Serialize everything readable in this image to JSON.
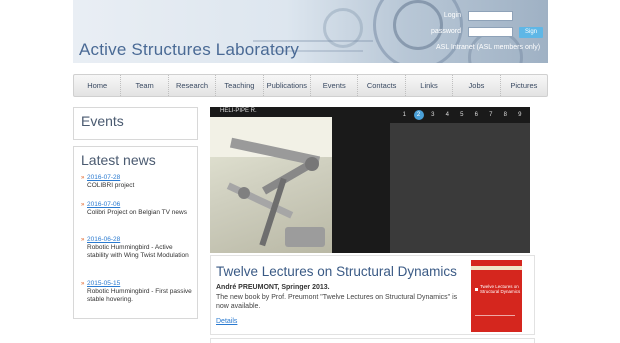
{
  "header": {
    "site_title": "Active Structures Laboratory",
    "login_label": "Login",
    "password_label": "password",
    "signin_label": "Sign",
    "intranet_text": "ASL Intranet (ASL members only)"
  },
  "nav": {
    "items": [
      "Home",
      "Team",
      "Research",
      "Teaching",
      "Publications",
      "Events",
      "Contacts",
      "Links",
      "Jobs",
      "Pictures"
    ]
  },
  "sidebar": {
    "events_title": "Events",
    "news_title": "Latest news",
    "news": [
      {
        "date": "2016-07-28",
        "text": "COLIBRI project"
      },
      {
        "date": "2016-07-06",
        "text": "Colibri Project on Belgian TV news"
      },
      {
        "date": "2016-06-28",
        "text": "Robotic Hummingbird - Active stability with Wing Twist Modulation"
      },
      {
        "date": "2015-05-15",
        "text": "Robotic Hummingbird - First passive stable hovering."
      }
    ]
  },
  "slider": {
    "caption": "HELI-PIPE R.",
    "dots": [
      "1",
      "2",
      "3",
      "4",
      "5",
      "6",
      "7",
      "8",
      "9"
    ],
    "active_index": 1
  },
  "article": {
    "title": "Twelve Lectures on Structural Dynamics",
    "author": "André PREUMONT, Springer 2013.",
    "body": "The new book by Prof. Preumont \"Twelve Lectures on Structural Dynamics\" is now available.",
    "link": "Details",
    "book_cover_text": "Twelve Lectures on Structural Dynamics"
  },
  "colors": {
    "accent_blue": "#4aa0d8",
    "link_blue": "#2a7ad0",
    "title_blue": "#4a6a95",
    "book_red": "#d5261e"
  }
}
